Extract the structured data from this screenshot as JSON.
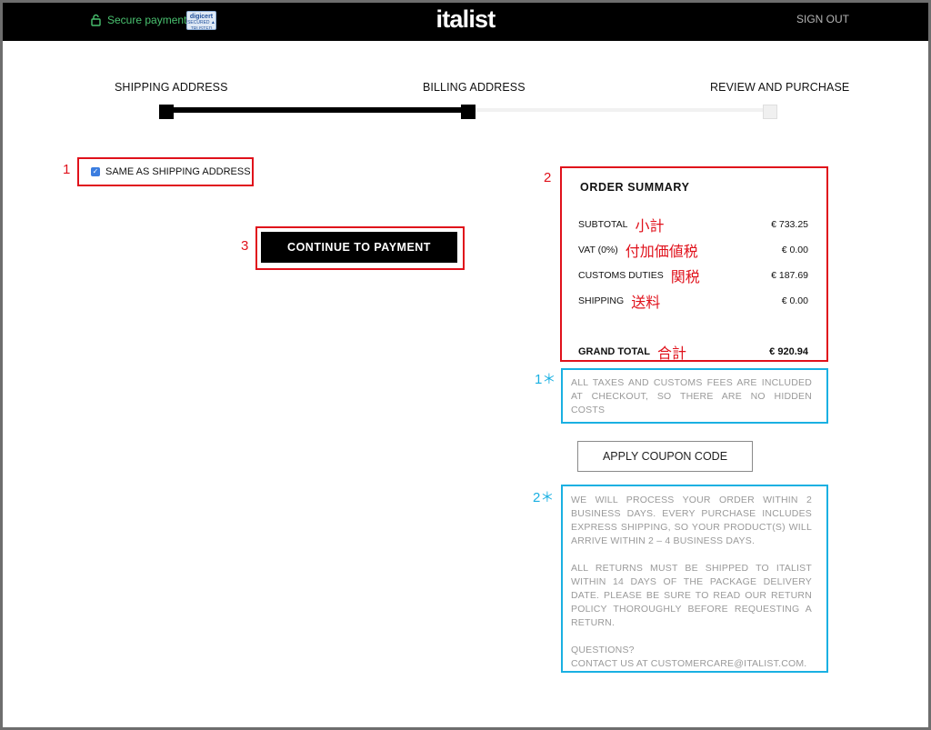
{
  "header": {
    "secure_label": "Secure payment",
    "badge_top": "digicert",
    "badge_bottom": "SECURED ▲ TRUSTED",
    "logo": "italist",
    "signout_label": "SIGN OUT",
    "secure_color": "#49c16f"
  },
  "steps": [
    {
      "label": "SHIPPING ADDRESS",
      "state": "done"
    },
    {
      "label": "BILLING ADDRESS",
      "state": "current"
    },
    {
      "label": "REVIEW AND PURCHASE",
      "state": "pending"
    }
  ],
  "billing": {
    "same_as_shipping_label": "SAME AS SHIPPING ADDRESS",
    "same_as_shipping_checked": true,
    "checkbox_color": "#3b7de0",
    "continue_label": "CONTINUE TO PAYMENT"
  },
  "summary": {
    "title": "ORDER SUMMARY",
    "rows": [
      {
        "label": "SUBTOTAL",
        "jp": "小計",
        "value": "€ 733.25"
      },
      {
        "label": "VAT (0%)",
        "jp": "付加価値税",
        "value": "€ 0.00"
      },
      {
        "label": "CUSTOMS DUTIES",
        "jp": "関税",
        "value": "€ 187.69"
      },
      {
        "label": "SHIPPING",
        "jp": "送料",
        "value": "€ 0.00"
      }
    ],
    "grand": {
      "label": "GRAND TOTAL",
      "jp": "合計",
      "value": "€ 920.94"
    }
  },
  "notes": {
    "taxes": "ALL TAXES AND CUSTOMS FEES ARE INCLUDED AT CHECKOUT, SO THERE ARE NO HIDDEN COSTS",
    "coupon_label": "APPLY COUPON CODE",
    "processing": "WE WILL PROCESS YOUR ORDER WITHIN 2 BUSINESS DAYS. EVERY PURCHASE INCLUDES EXPRESS SHIPPING, SO YOUR PRODUCT(S) WILL ARRIVE WITHIN 2 – 4 BUSINESS DAYS.",
    "returns": "ALL RETURNS MUST BE SHIPPED TO ITALIST WITHIN 14 DAYS OF THE PACKAGE DELIVERY DATE. PLEASE BE SURE TO READ OUR RETURN POLICY THOROUGHLY BEFORE REQUESTING A RETURN.",
    "questions": "QUESTIONS?",
    "contact": "CONTACT US AT CUSTOMERCARE@ITALIST.COM."
  },
  "annotations": {
    "red_color": "#e0111b",
    "blue_color": "#1ab0e2",
    "labels": {
      "a1": "1",
      "a2": "2",
      "a3": "3",
      "b1": "1＊",
      "b2": "2＊"
    }
  }
}
